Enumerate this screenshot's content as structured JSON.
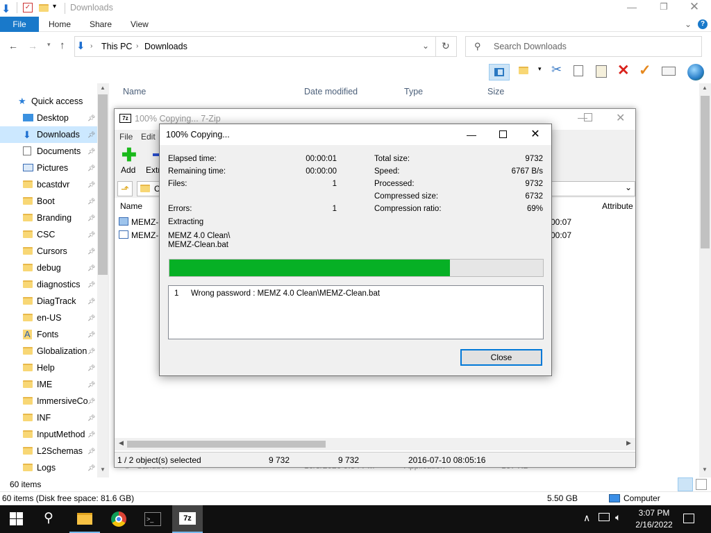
{
  "explorer": {
    "title": "Downloads",
    "tabs": {
      "file": "File",
      "home": "Home",
      "share": "Share",
      "view": "View"
    },
    "breadcrumb": {
      "pc": "This PC",
      "folder": "Downloads"
    },
    "search_placeholder": "Search Downloads",
    "columns": {
      "name": "Name",
      "date": "Date modified",
      "type": "Type",
      "size": "Size"
    },
    "nav": [
      {
        "label": "Quick access",
        "icon": "star-icon"
      },
      {
        "label": "Desktop",
        "icon": "desktop-icon"
      },
      {
        "label": "Downloads",
        "icon": "download-icon"
      },
      {
        "label": "Documents",
        "icon": "documents-icon"
      },
      {
        "label": "Pictures",
        "icon": "pictures-icon"
      },
      {
        "label": "bcastdvr",
        "icon": "folder-icon"
      },
      {
        "label": "Boot",
        "icon": "folder-icon"
      },
      {
        "label": "Branding",
        "icon": "folder-icon"
      },
      {
        "label": "CSC",
        "icon": "folder-icon"
      },
      {
        "label": "Cursors",
        "icon": "folder-icon"
      },
      {
        "label": "debug",
        "icon": "folder-icon"
      },
      {
        "label": "diagnostics",
        "icon": "folder-icon"
      },
      {
        "label": "DiagTrack",
        "icon": "folder-icon"
      },
      {
        "label": "en-US",
        "icon": "folder-icon"
      },
      {
        "label": "Fonts",
        "icon": "fonts-icon"
      },
      {
        "label": "Globalization",
        "icon": "folder-icon"
      },
      {
        "label": "Help",
        "icon": "folder-icon"
      },
      {
        "label": "IME",
        "icon": "folder-icon"
      },
      {
        "label": "ImmersiveCo",
        "icon": "folder-icon"
      },
      {
        "label": "INF",
        "icon": "folder-icon"
      },
      {
        "label": "InputMethod",
        "icon": "folder-icon"
      },
      {
        "label": "L2Schemas",
        "icon": "folder-icon"
      },
      {
        "label": "Logs",
        "icon": "folder-icon"
      }
    ],
    "hidden_row": {
      "name": "Sandbox",
      "date": "10/5/2020 9:54 PM",
      "type": "Application",
      "size": "167 KB"
    },
    "status_items": "60 items",
    "details_left": "60 items (Disk free space: 81.6 GB)",
    "details_size": "5.50 GB",
    "details_location": "Computer"
  },
  "zip": {
    "title": "100% Copying... 7-Zip",
    "menu_file": "File",
    "menu_edit": "Edit",
    "tool_add": "Add",
    "tool_extract": "Extr",
    "path_partial": "C",
    "col_name": "Name",
    "col_attributes": "Attribute",
    "rows": [
      {
        "name": "MEMZ-",
        "time": "00:07"
      },
      {
        "name": "MEMZ-",
        "time": "00:07"
      }
    ],
    "status": {
      "selected": "1 / 2 object(s) selected",
      "size1": "9 732",
      "size2": "9 732",
      "date": "2016-07-10 08:05:16"
    }
  },
  "dialog": {
    "title": "100% Copying...",
    "elapsed_label": "Elapsed time:",
    "elapsed": "00:00:01",
    "remaining_label": "Remaining time:",
    "remaining": "00:00:00",
    "files_label": "Files:",
    "files": "1",
    "errors_label": "Errors:",
    "errors": "1",
    "total_label": "Total size:",
    "total": "9732",
    "speed_label": "Speed:",
    "speed": "6767 B/s",
    "processed_label": "Processed:",
    "processed": "9732",
    "compressed_label": "Compressed size:",
    "compressed": "6732",
    "ratio_label": "Compression ratio:",
    "ratio": "69%",
    "operation": "Extracting",
    "path_line1": "MEMZ 4.0 Clean\\",
    "path_line2": "MEMZ-Clean.bat",
    "progress": 0.75,
    "message_index": "1",
    "message": "Wrong password : MEMZ 4.0 Clean\\MEMZ-Clean.bat",
    "close_label": "Close"
  },
  "taskbar": {
    "time": "3:07 PM",
    "date": "2/16/2022"
  },
  "colors": {
    "accent": "#1979ca",
    "progress": "#06b025"
  }
}
